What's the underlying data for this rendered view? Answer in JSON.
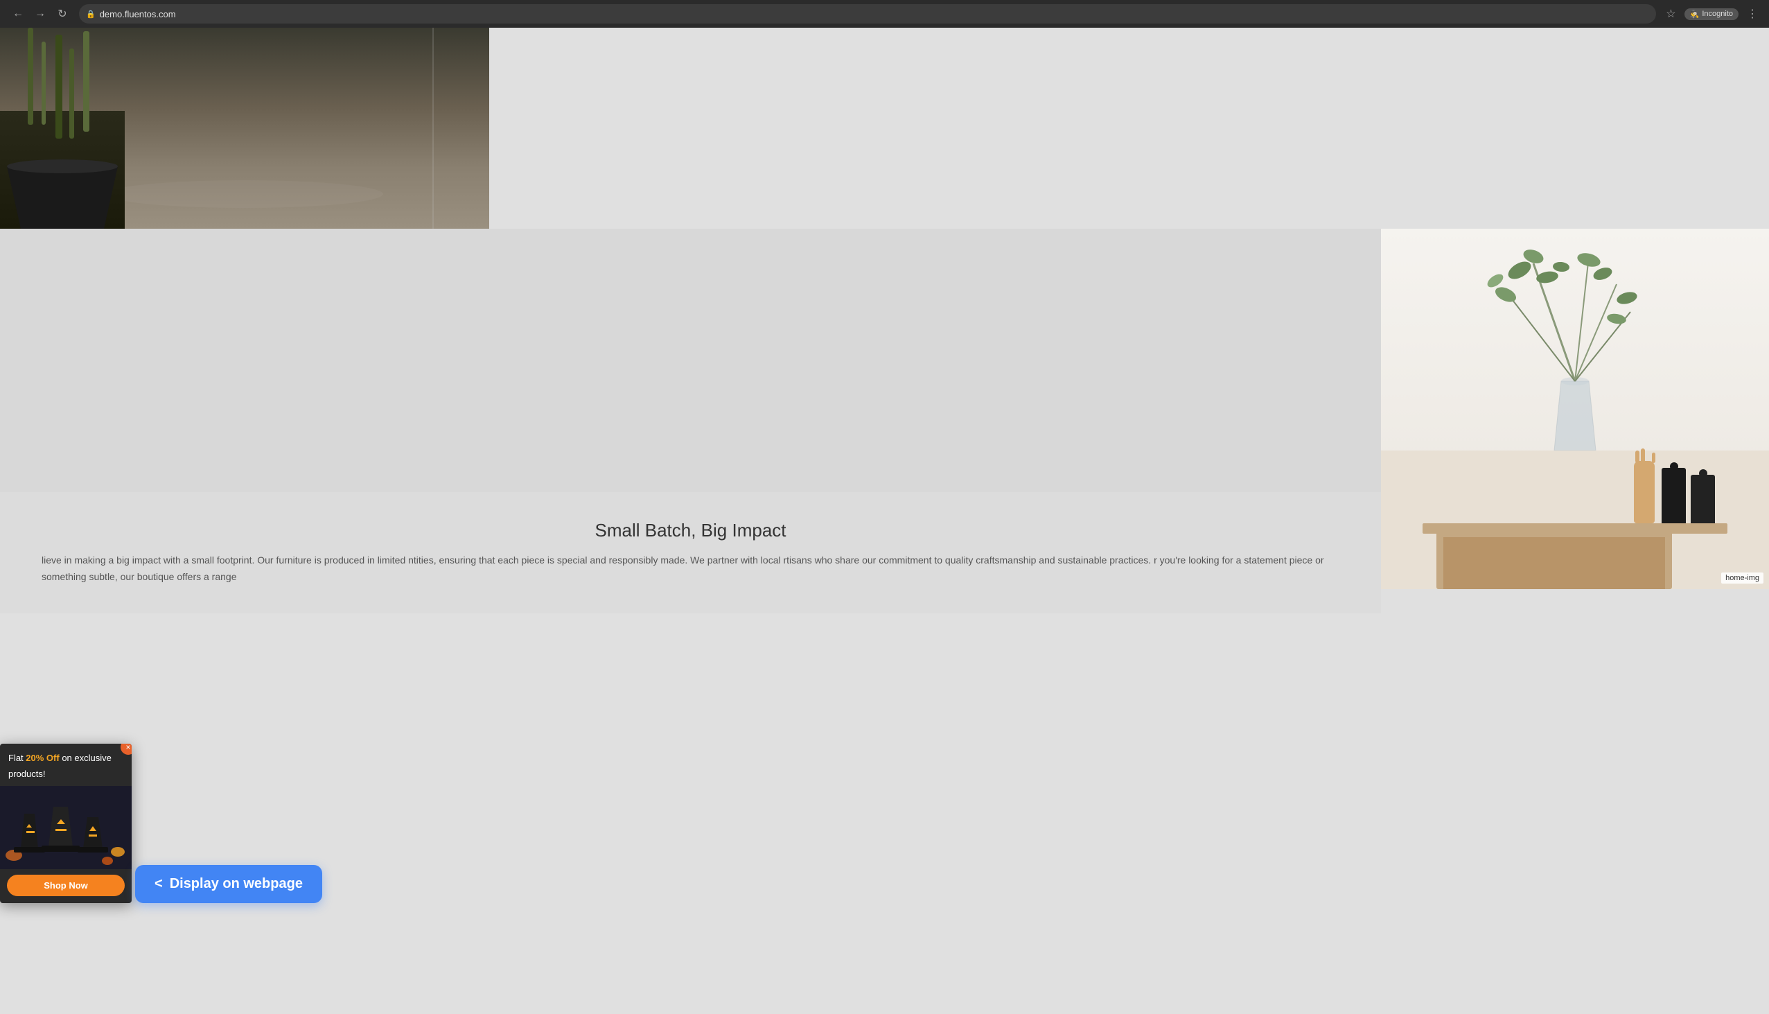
{
  "browser": {
    "url": "demo.fluentos.com",
    "incognito_label": "Incognito",
    "back_title": "Back",
    "forward_title": "Forward",
    "refresh_title": "Refresh"
  },
  "ad_popup": {
    "close_label": "×",
    "flat_text": "Flat ",
    "discount_text": "20% Off",
    "suffix_text": " on exclusive products!",
    "shop_btn_label": "Shop Now"
  },
  "display_button": {
    "label": "Display on webpage",
    "arrow": "<"
  },
  "main_content": {
    "section_title": "Small Batch, Big Impact",
    "section_text": "lieve in making a big impact with a small footprint. Our furniture is produced in limited ntities, ensuring that each piece is special and responsibly made. We partner with local rtisans who share our commitment to quality craftsmanship and sustainable practices. r you're looking for a statement piece or something subtle, our boutique offers a range",
    "home_img_label": "home-img"
  }
}
